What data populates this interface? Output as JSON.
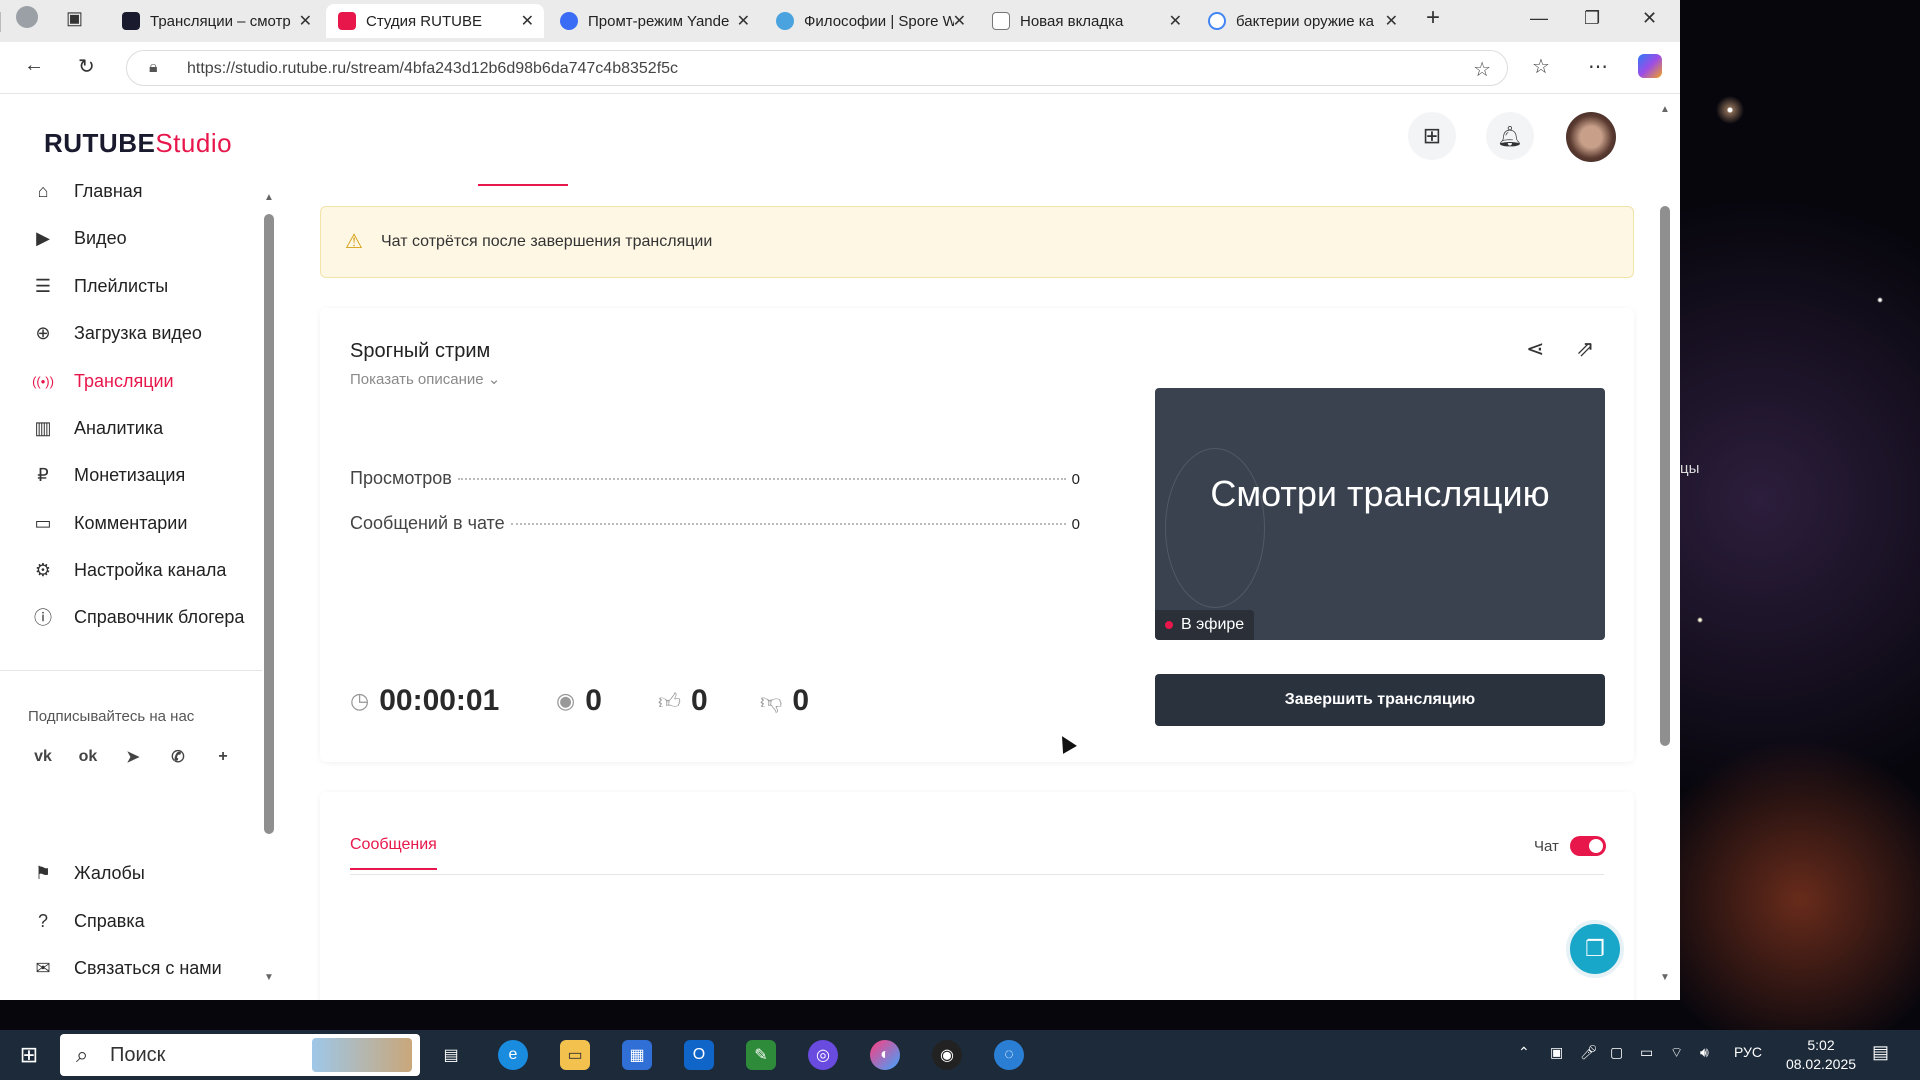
{
  "browser": {
    "tabs": [
      {
        "title": "Трансляции – смотр",
        "color": "#e8174b"
      },
      {
        "title": "Студия RUTUBE",
        "color": "#e8174b"
      },
      {
        "title": "Промт-режим Yande",
        "color": "#3b6cf5"
      },
      {
        "title": "Философии | Spore W",
        "color": "#4aa3df"
      },
      {
        "title": "Новая вкладка",
        "color": "#777777"
      },
      {
        "title": "бактерии оружие ка",
        "color": "#4285f4"
      }
    ],
    "url": "https://studio.rutube.ru/stream/4bfa243d12b6d98b6da747c4b8352f5c"
  },
  "header": {
    "logo_main": "RUTUBE",
    "logo_accent": "Studio"
  },
  "sidebar": {
    "items": [
      {
        "label": "Главная",
        "icon": "home-icon",
        "glyph": "⌂"
      },
      {
        "label": "Видео",
        "icon": "video-icon",
        "glyph": "▶"
      },
      {
        "label": "Плейлисты",
        "icon": "playlist-icon",
        "glyph": "☰"
      },
      {
        "label": "Загрузка видео",
        "icon": "upload-icon",
        "glyph": "⊕"
      },
      {
        "label": "Трансляции",
        "icon": "broadcast-icon",
        "glyph": "((•))"
      },
      {
        "label": "Аналитика",
        "icon": "analytics-icon",
        "glyph": "▥"
      },
      {
        "label": "Монетизация",
        "icon": "ruble-icon",
        "glyph": "₽"
      },
      {
        "label": "Комментарии",
        "icon": "comment-icon",
        "glyph": "▭"
      },
      {
        "label": "Настройка канала",
        "icon": "gear-icon",
        "glyph": "⚙"
      },
      {
        "label": "Справочник блогера",
        "icon": "info-icon",
        "glyph": "ⓘ"
      }
    ],
    "subscribe_label": "Подписывайтесь на нас",
    "socials": [
      {
        "name": "vk-icon",
        "glyph": "vk"
      },
      {
        "name": "odnoklassniki-icon",
        "glyph": "ok"
      },
      {
        "name": "telegram-icon",
        "glyph": "➤"
      },
      {
        "name": "viber-icon",
        "glyph": "✆"
      },
      {
        "name": "more-icon",
        "glyph": "+"
      }
    ],
    "bottom_items": [
      {
        "label": "Жалобы",
        "icon": "flag-icon",
        "glyph": "⚑"
      },
      {
        "label": "Справка",
        "icon": "help-icon",
        "glyph": "?"
      },
      {
        "label": "Связаться с нами",
        "icon": "mail-icon",
        "glyph": "✉"
      }
    ]
  },
  "notice": {
    "text": "Чат сотрётся после завершения трансляции"
  },
  "stream": {
    "title": "Spoгный стрим",
    "show_description": "Показать описание",
    "stats": [
      {
        "label": "Просмотров",
        "value": "0"
      },
      {
        "label": "Сообщений в чате",
        "value": "0"
      }
    ],
    "metrics": {
      "duration": "00:00:01",
      "viewers": "0",
      "likes": "0",
      "dislikes": "0"
    },
    "preview_text": "Смотри трансляцию",
    "live_label": "В эфире",
    "end_button": "Завершить трансляцию"
  },
  "chat": {
    "messages_tab": "Сообщения",
    "chat_label": "Чат",
    "chat_enabled": true
  },
  "taskbar": {
    "search": "Поиск",
    "lang": "РУС",
    "time": "5:02",
    "date": "08.02.2025"
  },
  "desktop_text": "цы",
  "colors": {
    "accent": "#e8174b",
    "dark_button": "#2a323d",
    "notice_bg": "#fdf7e4"
  }
}
